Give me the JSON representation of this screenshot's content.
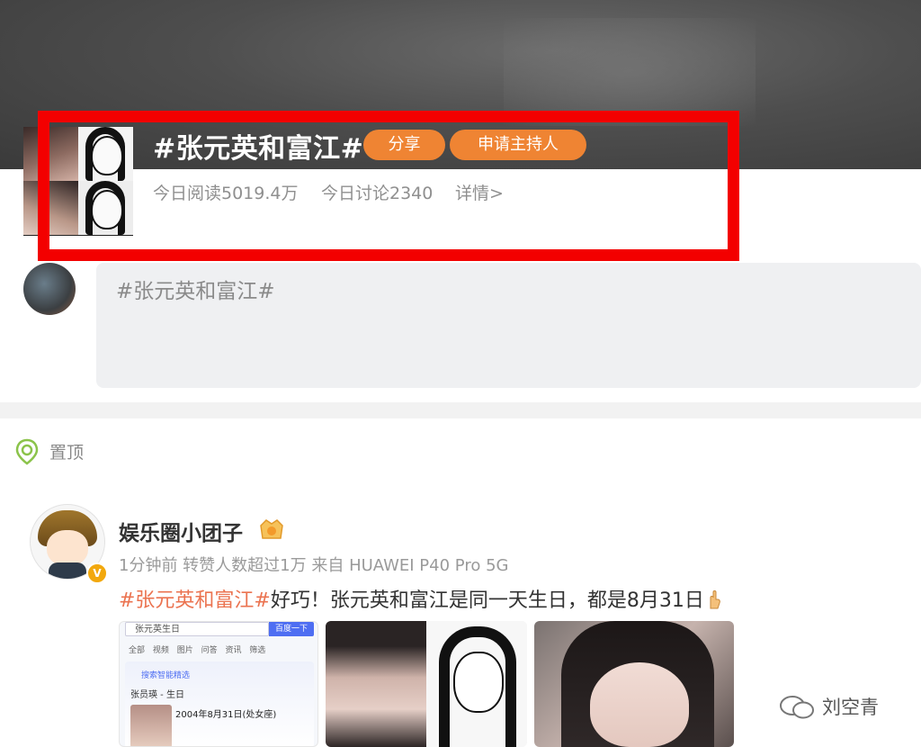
{
  "topic": {
    "title": "#张元英和富江#",
    "share_label": "分享",
    "apply_host_label": "申请主持人",
    "reads_today": "今日阅读5019.4万",
    "discussions_today": "今日讨论2340",
    "details_link": "详情>"
  },
  "composer": {
    "prefill_text": "#张元英和富江#"
  },
  "pinned": {
    "label": "置顶"
  },
  "post": {
    "username": "娱乐圈小团子",
    "verified_badge": "V",
    "meta": "1分钟前 转赞人数超过1万  来自 HUAWEI P40 Pro 5G",
    "hashtag": "#张元英和富江#",
    "body": "好巧！张元英和富江是同一天生日，都是8月31日",
    "images": [
      {
        "search_query": "张元英生日",
        "search_button": "百度一下",
        "tabs": "全部 视频 图片 问答 资讯 筛选",
        "ai_label": "搜索智能精选",
        "result_name": "张员瑛 - 生日",
        "result_date": "2004年8月31日(处女座)"
      },
      {},
      {}
    ]
  },
  "watermark": {
    "text": "刘空青"
  },
  "colors": {
    "accent_orange": "#ef8433",
    "hashtag_orange": "#eb7350",
    "annotation_red": "#f30000",
    "verified_gold": "#f2a80d"
  },
  "icons": {
    "pin": "pin-location-icon",
    "level": "level-badge-icon",
    "hand": "pointing-hand-emoji",
    "wechat": "wechat-icon"
  }
}
